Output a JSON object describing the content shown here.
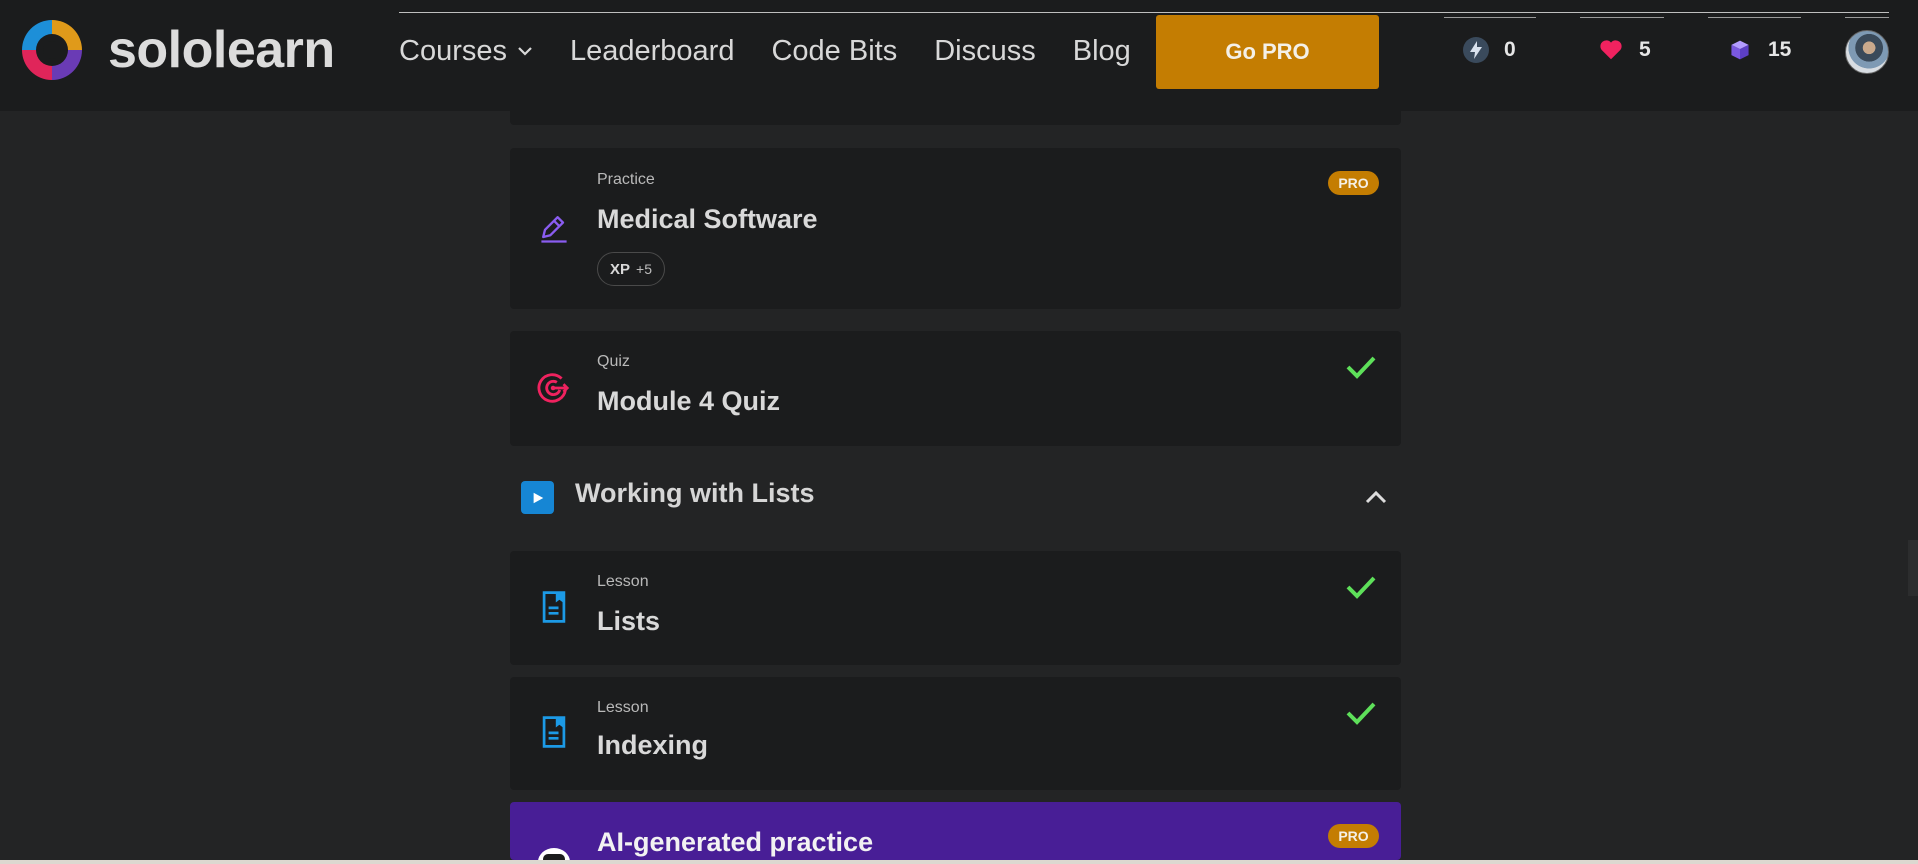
{
  "header": {
    "logo_text": "sololearn",
    "nav": {
      "courses": "Courses",
      "leaderboard": "Leaderboard",
      "code_bits": "Code Bits",
      "discuss": "Discuss",
      "blog": "Blog"
    },
    "go_pro": "Go PRO",
    "stats": {
      "streak": "0",
      "hearts": "5",
      "bits": "15"
    },
    "colors": {
      "accent_pro": "#c47d02",
      "heart": "#f0225f",
      "bits": "#8b6cf0"
    }
  },
  "items": [
    {
      "type": "Practice",
      "title": "Medical Software",
      "badge": "PRO",
      "xp_label": "XP",
      "xp_value": "+5",
      "icon": "pencil-edit-icon"
    },
    {
      "type": "Quiz",
      "title": "Module 4 Quiz",
      "completed": true,
      "icon": "target-icon"
    },
    {
      "type": "Lesson",
      "title": "Lists",
      "completed": true,
      "icon": "lesson-document-icon"
    },
    {
      "type": "Lesson",
      "title": "Indexing",
      "completed": true,
      "icon": "lesson-document-icon"
    },
    {
      "title": "AI-generated practice",
      "badge": "PRO",
      "icon": "ai-robot-icon"
    }
  ],
  "section": {
    "title": "Working with Lists",
    "icon": "play-icon",
    "expanded": true
  }
}
